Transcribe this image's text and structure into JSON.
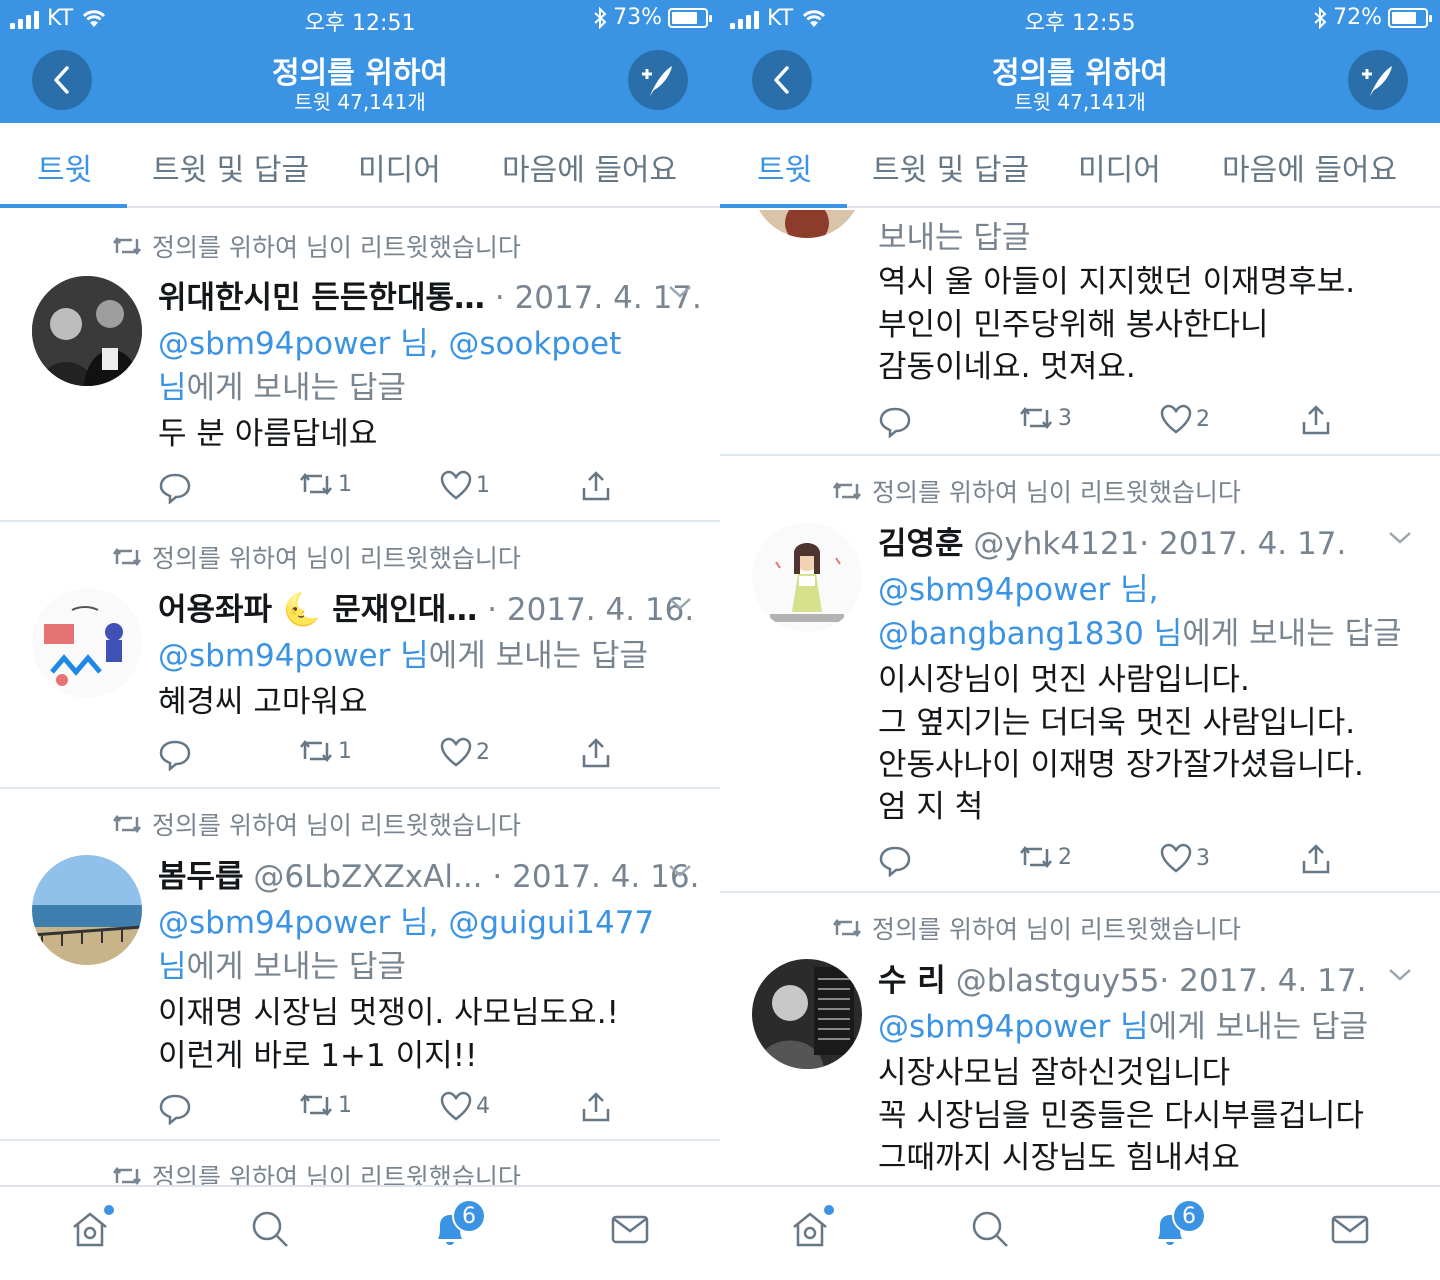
{
  "left": {
    "status": {
      "carrier": "KT",
      "time": "오후 12:51",
      "battery": "73%"
    },
    "header": {
      "title": "정의를 위하여",
      "subtitle": "트윗 47,141개"
    },
    "tabs": [
      "트윗",
      "트윗 및 답글",
      "미디어",
      "마음에 들어요"
    ],
    "tweets": [
      {
        "retweeted_by": "정의를 위하여 님이 리트윗했습니다",
        "name": "위대한시민 든든한대통…",
        "handle": "",
        "date": "· 2017. 4. 17.",
        "reply_l1_blue": "@sbm94power 님, @sookpoet",
        "reply_l2_blue": "님",
        "reply_l2_text": "에게 보내는 답글",
        "body": [
          "두 분 아름답네요"
        ],
        "retweets": "1",
        "likes": "1"
      },
      {
        "retweeted_by": "정의를 위하여 님이 리트윗했습니다",
        "name": "어용좌파 🌜 문재인대…",
        "handle": "",
        "date": "· 2017. 4. 16.",
        "reply_l1_blue": "@sbm94power 님",
        "reply_l1_text": "에게 보내는 답글",
        "body": [
          "혜경씨 고마워요"
        ],
        "retweets": "1",
        "likes": "2"
      },
      {
        "retweeted_by": "정의를 위하여 님이 리트윗했습니다",
        "name": "봄두릅",
        "handle": "@6LbZXZxAl...",
        "date": "· 2017. 4. 16.",
        "reply_l1_blue": "@sbm94power 님, @guigui1477",
        "reply_l2_blue": "님",
        "reply_l2_text": "에게 보내는 답글",
        "body": [
          "이재명 시장님 멋쟁이.  사모님도요.!",
          "이런게 바로 1+1 이지!!"
        ],
        "retweets": "1",
        "likes": "4"
      },
      {
        "retweeted_by": "정의를 위하여 님이 리트윗했습니다"
      }
    ],
    "tabbar": {
      "notifications": "6"
    }
  },
  "right": {
    "status": {
      "carrier": "KT",
      "time": "오후 12:55",
      "battery": "72%"
    },
    "header": {
      "title": "정의를 위하여",
      "subtitle": "트윗 47,141개"
    },
    "tabs": [
      "트윗",
      "트윗 및 답글",
      "미디어",
      "마음에 들어요"
    ],
    "partial": {
      "reply_tail": "보내는 답글",
      "body": [
        "역시 울 아들이 지지했던 이재명후보.",
        "부인이 민주당위해 봉사한다니",
        "감동이네요. 멋져요."
      ],
      "retweets": "3",
      "likes": "2"
    },
    "tweets": [
      {
        "retweeted_by": "정의를 위하여 님이 리트윗했습니다",
        "name": "김영훈",
        "handle": "@yhk4121",
        "date": "· 2017. 4. 17.",
        "reply_l1_blue": "@sbm94power 님,",
        "reply_l2_blue": "@bangbang1830 님",
        "reply_l2_text": "에게 보내는 답글",
        "body": [
          "이시장님이 멋진 사람입니다.",
          "그 옆지기는 더더욱 멋진 사람입니다.",
          "안동사나이  이재명  장가잘가셨읍니다.",
          "엄 지 척"
        ],
        "retweets": "2",
        "likes": "3"
      },
      {
        "retweeted_by": "정의를 위하여 님이 리트윗했습니다",
        "name": "수 리",
        "handle": "@blastguy55",
        "date": "· 2017. 4. 17.",
        "reply_l1_blue": "@sbm94power 님",
        "reply_l1_text": "에게 보내는 답글",
        "body": [
          "시장사모님 잘하신것입니다",
          "꼭 시장님을 민중들은 다시부를겁니다",
          "그때까지 시장님도 힘내셔요"
        ]
      }
    ],
    "tabbar": {
      "notifications": "6"
    }
  },
  "colors": {
    "accent": "#3b93e4",
    "header_button": "#2a6fa9",
    "text": "#14171a",
    "muted": "#788591"
  }
}
